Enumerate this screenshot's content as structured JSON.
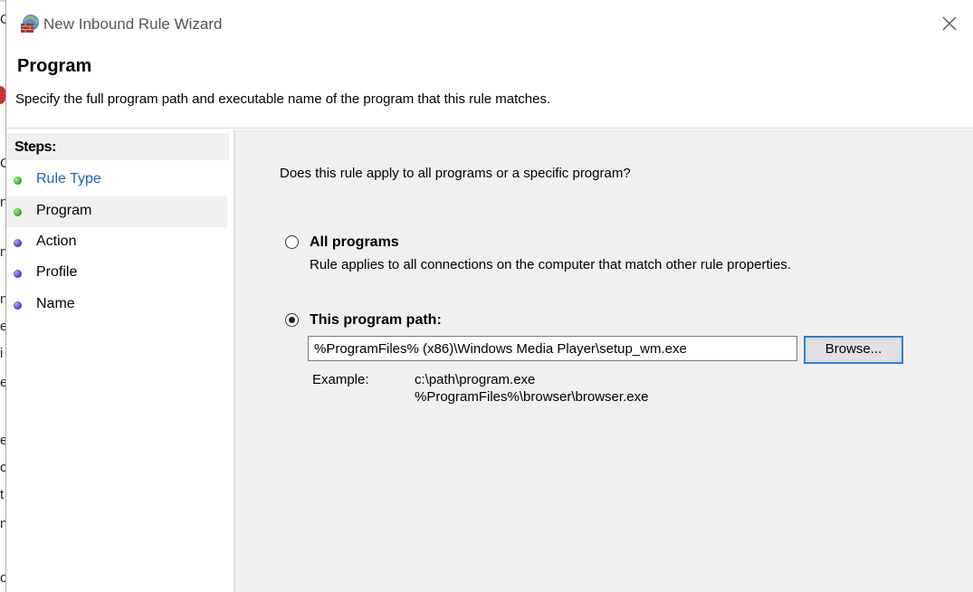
{
  "window": {
    "title": "New Inbound Rule Wizard"
  },
  "header": {
    "title": "Program",
    "description": "Specify the full program path and executable name of the program that this rule matches."
  },
  "steps": {
    "heading": "Steps:",
    "items": [
      {
        "label": "Rule Type",
        "status": "completed",
        "color": "#3aa62b"
      },
      {
        "label": "Program",
        "status": "current",
        "color": "#3aa62b"
      },
      {
        "label": "Action",
        "status": "pending",
        "color": "#4a44cc"
      },
      {
        "label": "Profile",
        "status": "pending",
        "color": "#4a44cc"
      },
      {
        "label": "Name",
        "status": "pending",
        "color": "#4a44cc"
      }
    ]
  },
  "content": {
    "question": "Does this rule apply to all programs or a specific program?",
    "options": [
      {
        "label": "All programs",
        "description": "Rule applies to all connections on the computer that match other rule properties.",
        "selected": false
      },
      {
        "label": "This program path:",
        "selected": true
      }
    ],
    "path_value": "%ProgramFiles% (x86)\\Windows Media Player\\setup_wm.exe",
    "browse_label": "Browse...",
    "example_label": "Example:",
    "example_lines": [
      "c:\\path\\program.exe",
      "%ProgramFiles%\\browser\\browser.exe"
    ]
  },
  "background_fragments": [
    "O",
    "C",
    "n",
    "n",
    "n",
    "e",
    "i",
    "e",
    "e",
    "o",
    "t",
    "n",
    "o"
  ],
  "colors": {
    "link": "#1e63c2",
    "content_bg": "#f0f0f0",
    "focus_border": "#2a7fd4"
  }
}
